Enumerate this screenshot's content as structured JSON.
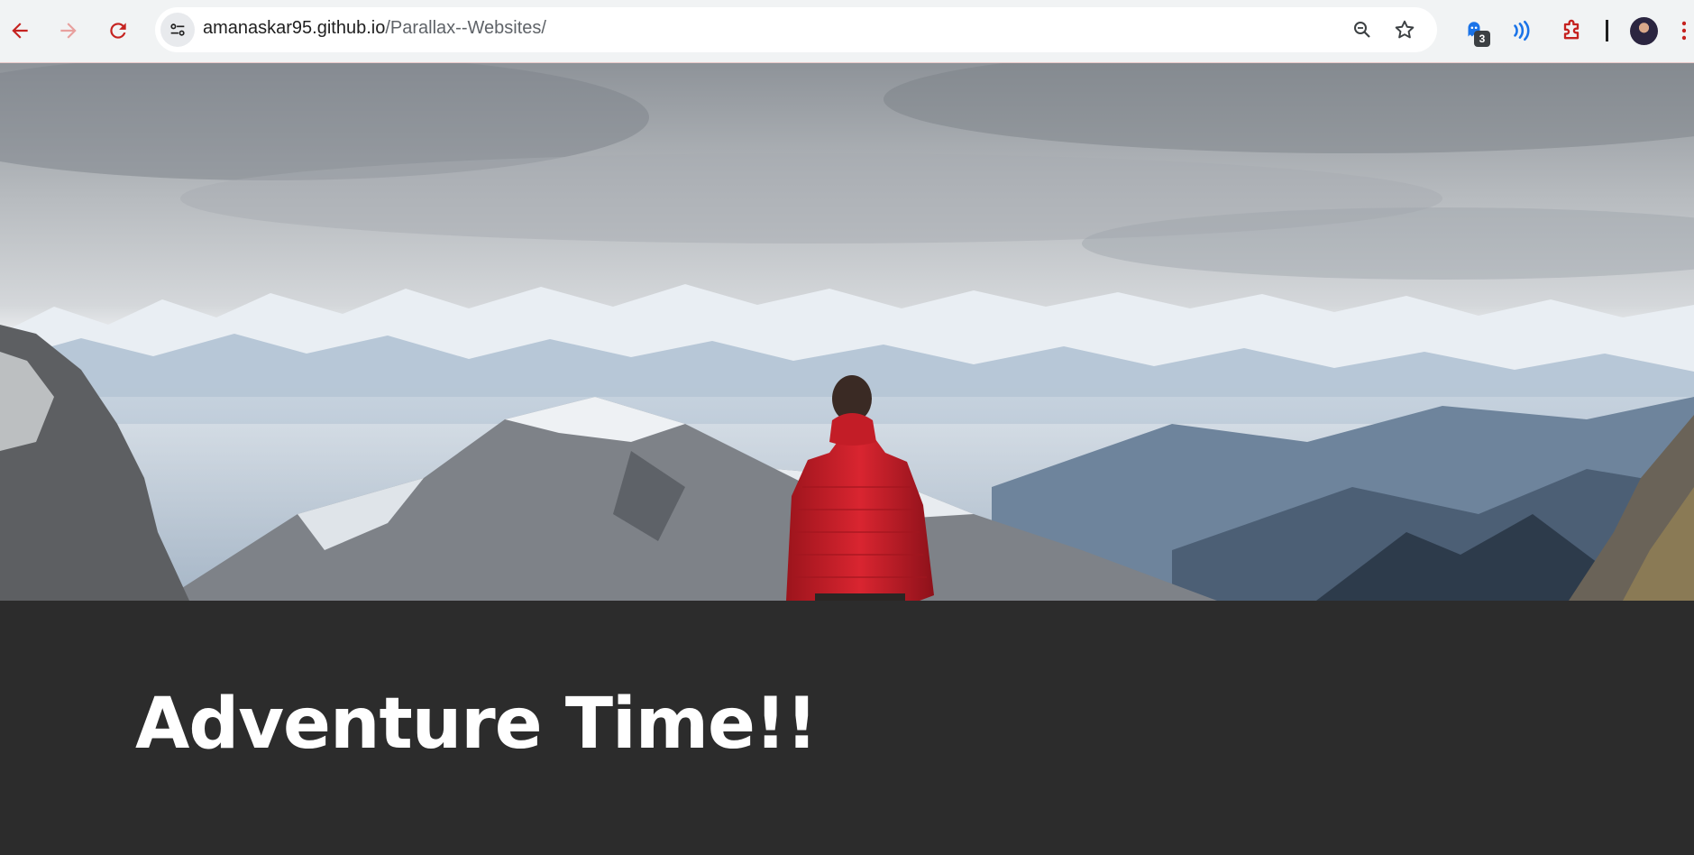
{
  "browser": {
    "url_host": "amanaskar95.github.io",
    "url_path": "/Parallax--Websites/",
    "extension_badge_count": "3",
    "accent_color": "#c5221f"
  },
  "icons": {
    "back": "back-arrow-icon",
    "forward": "forward-arrow-icon",
    "reload": "reload-icon",
    "site_info": "tune-icon",
    "zoom": "zoom-icon",
    "bookmark": "star-icon",
    "extension_1": "extension-badge-icon",
    "extension_2": "broadcast-icon",
    "extensions": "puzzle-icon",
    "menu": "kebab-menu-icon"
  },
  "page": {
    "hero_image": "mountain landscape with hiker in red jacket",
    "heading": "Adventure Time!!",
    "background_color": "#2c2c2c"
  }
}
